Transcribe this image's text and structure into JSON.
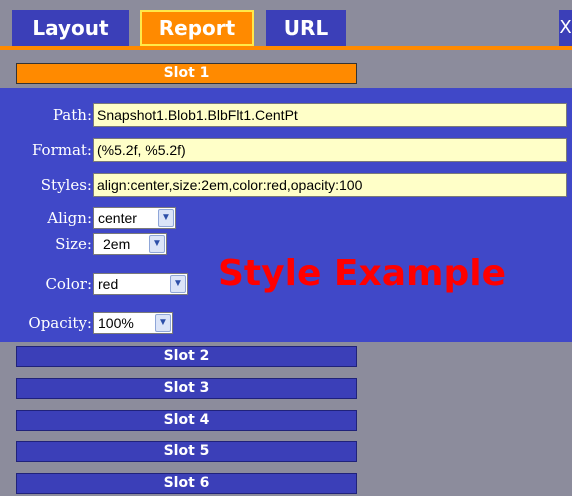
{
  "tabs": [
    {
      "label": "Layout",
      "active": false
    },
    {
      "label": "Report",
      "active": true
    },
    {
      "label": "URL",
      "active": false
    }
  ],
  "close_label": "X",
  "slots": [
    {
      "label": "Slot 1",
      "active": true
    },
    {
      "label": "Slot 2"
    },
    {
      "label": "Slot 3"
    },
    {
      "label": "Slot 4"
    },
    {
      "label": "Slot 5"
    },
    {
      "label": "Slot 6"
    }
  ],
  "form": {
    "path": {
      "label": "Path:",
      "value": "Snapshot1.Blob1.BlbFlt1.CentPt"
    },
    "format": {
      "label": "Format:",
      "value": "(%5.2f, %5.2f)"
    },
    "styles": {
      "label": "Styles:",
      "value": "align:center,size:2em,color:red,opacity:100"
    },
    "align": {
      "label": "Align:",
      "value": "center"
    },
    "size": {
      "label": "Size:",
      "value": "2em"
    },
    "color": {
      "label": "Color:",
      "value": "red"
    },
    "opacity": {
      "label": "Opacity:",
      "value": "100%"
    }
  },
  "style_example": {
    "text": "Style Example",
    "color": "#ff0000"
  },
  "colors": {
    "accent": "#ff8a00",
    "panel": "#4048c8",
    "tab": "#3b3fb8",
    "background": "#8c8c9c",
    "field": "#ffffc8"
  }
}
